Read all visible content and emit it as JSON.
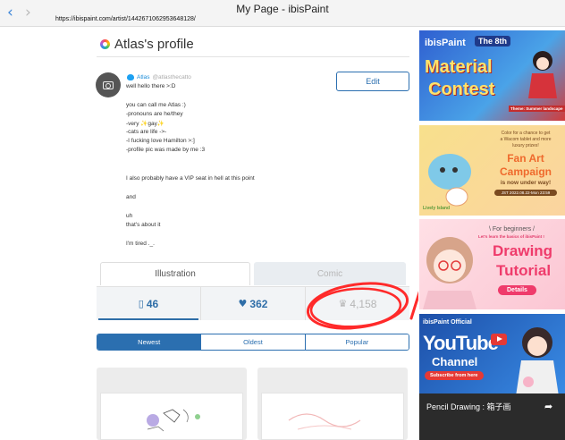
{
  "browser": {
    "back_icon": "chevron-left-icon",
    "forward_icon": "chevron-right-icon",
    "title": "My Page - ibisPaint",
    "url": "https://ibispaint.com/artist/1442671062953648128/"
  },
  "profile": {
    "title": "Atlas's profile",
    "twitter_name": "Atlas",
    "twitter_handle": "@atlasthecatto",
    "edit_label": "Edit",
    "bio": [
      "well hello there >:D",
      "you can call me Atlas :)",
      "-pronouns are he/they",
      "-very ✨gay✨",
      "-cats are life ->-",
      "-I fucking love Hamilton >:]",
      "-profile pic was made by me :3",
      "I also probably have a VIP seat in hell at this point",
      "and",
      "uh",
      "that's about it",
      "I'm tired ._."
    ]
  },
  "tabs": [
    {
      "label": "Illustration",
      "active": true
    },
    {
      "label": "Comic",
      "active": false
    }
  ],
  "stats": [
    {
      "icon": "artwork-icon",
      "glyph": "▯",
      "value": "46"
    },
    {
      "icon": "heart-icon",
      "glyph": "♥",
      "value": "362"
    },
    {
      "icon": "crown-icon",
      "glyph": "♛",
      "value": "4,158"
    }
  ],
  "sort": [
    "Newest",
    "Oldest",
    "Popular"
  ],
  "sidebar": {
    "banner1": {
      "brand": "ibisPaint",
      "badge": "The 8th",
      "line1": "Material",
      "line2": "Contest",
      "theme": "Theme: Summer landscape"
    },
    "banner2": {
      "line1": "Color for a chance to get",
      "line2": "a Wacom tablet and more",
      "line3": "luxury prizes!",
      "title1": "Fan Art",
      "title2": "Campaign",
      "sub": "is now under way!",
      "date": "JST 2022.08.22-Mon 23:59",
      "brand": "Lively Island"
    },
    "banner3": {
      "line1": "\\ For beginners /",
      "line2": "Let's learn the basics of ibisPaint !",
      "title1": "Drawing",
      "title2": "Tutorial",
      "button": "Details"
    },
    "banner4": {
      "label": "ibisPaint Official",
      "title": "YouTube",
      "sub": "Channel",
      "button": "Subscribe from here"
    },
    "banner5": {
      "title": "Pencil Drawing : 箱子画"
    }
  },
  "colors": {
    "accent": "#2b6fb0",
    "annotation": "#ff2a2a"
  }
}
